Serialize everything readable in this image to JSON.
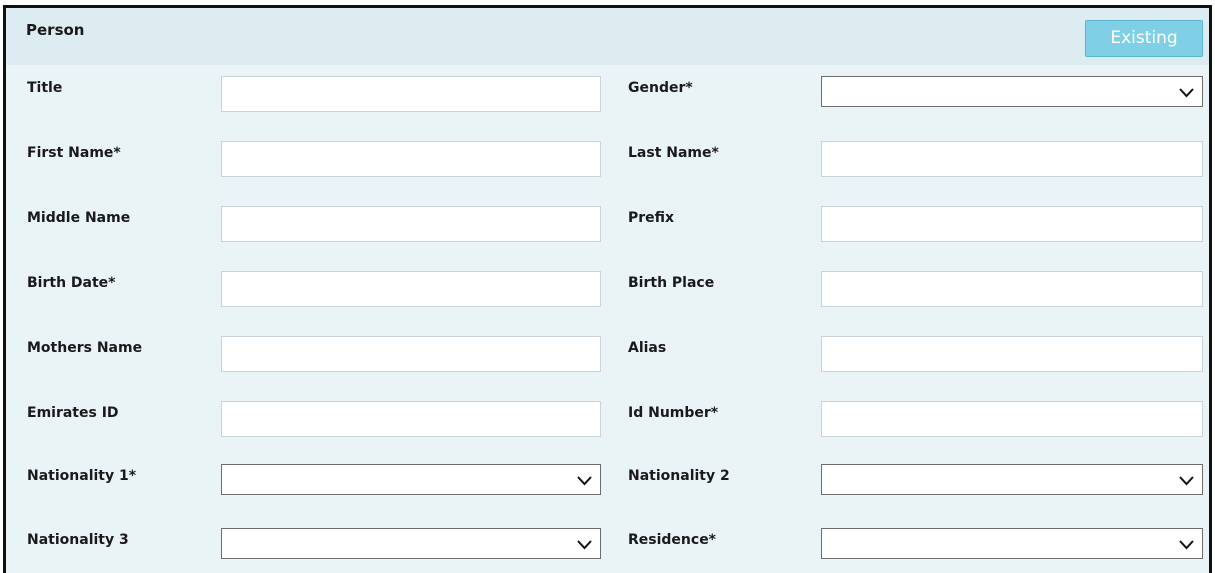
{
  "panel": {
    "title": "Person",
    "existing_button": "Existing"
  },
  "fields": {
    "title": {
      "label": "Title",
      "value": ""
    },
    "gender": {
      "label": "Gender*",
      "value": ""
    },
    "first_name": {
      "label": "First Name*",
      "value": ""
    },
    "last_name": {
      "label": "Last Name*",
      "value": ""
    },
    "middle_name": {
      "label": "Middle Name",
      "value": ""
    },
    "prefix": {
      "label": "Prefix",
      "value": ""
    },
    "birth_date": {
      "label": "Birth Date*",
      "value": ""
    },
    "birth_place": {
      "label": "Birth Place",
      "value": ""
    },
    "mothers_name": {
      "label": "Mothers Name",
      "value": ""
    },
    "alias": {
      "label": "Alias",
      "value": ""
    },
    "emirates_id": {
      "label": "Emirates ID",
      "value": ""
    },
    "id_number": {
      "label": "Id Number*",
      "value": ""
    },
    "nationality_1": {
      "label": "Nationality 1*",
      "value": ""
    },
    "nationality_2": {
      "label": "Nationality 2",
      "value": ""
    },
    "nationality_3": {
      "label": "Nationality 3",
      "value": ""
    },
    "residence": {
      "label": "Residence*",
      "value": ""
    }
  },
  "icons": {
    "dropdown": "chevron-down-icon"
  }
}
